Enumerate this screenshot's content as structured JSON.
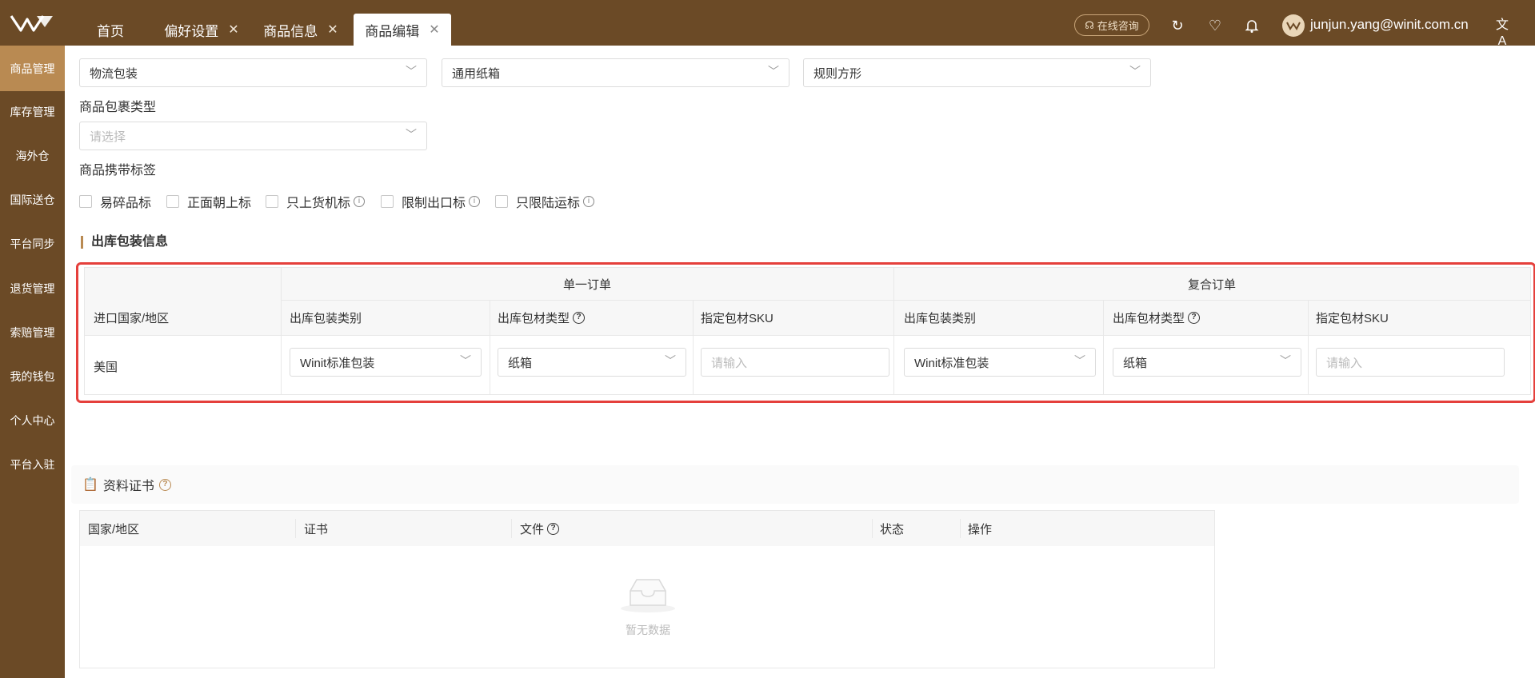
{
  "tabs": [
    {
      "label": "首页",
      "closable": false,
      "active": false
    },
    {
      "label": "偏好设置",
      "closable": true,
      "active": false
    },
    {
      "label": "商品信息",
      "closable": true,
      "active": false
    },
    {
      "label": "商品编辑",
      "closable": true,
      "active": true
    }
  ],
  "header": {
    "consult_label": "在线咨询",
    "username": "junjun.yang@winit.com.cn",
    "icons": [
      "refresh-icon",
      "shield-heart-icon",
      "bell-icon",
      "translate-icon"
    ]
  },
  "sidebar": {
    "items": [
      {
        "label": "商品管理",
        "active": true
      },
      {
        "label": "库存管理",
        "active": false
      },
      {
        "label": "海外仓",
        "active": false
      },
      {
        "label": "国际送仓",
        "active": false
      },
      {
        "label": "平台同步",
        "active": false
      },
      {
        "label": "退货管理",
        "active": false
      },
      {
        "label": "索赔管理",
        "active": false
      },
      {
        "label": "我的钱包",
        "active": false
      },
      {
        "label": "个人中心",
        "active": false
      },
      {
        "label": "平台入驻",
        "active": false
      }
    ]
  },
  "form": {
    "top_selects": [
      "物流包装",
      "通用纸箱",
      "规则方形"
    ],
    "package_type_label": "商品包裹类型",
    "package_type_placeholder": "请选择",
    "tags_label": "商品携带标签",
    "tags": [
      {
        "label": "易碎品标",
        "info": false
      },
      {
        "label": "正面朝上标",
        "info": false
      },
      {
        "label": "只上货机标",
        "info": true
      },
      {
        "label": "限制出口标",
        "info": true
      },
      {
        "label": "只限陆运标",
        "info": true
      }
    ]
  },
  "outbound": {
    "title": "出库包装信息",
    "group_single": "单一订单",
    "group_combined": "复合订单",
    "col_country": "进口国家/地区",
    "col_pack_category": "出库包装类别",
    "col_material_type": "出库包材类型",
    "col_sku": "指定包材SKU",
    "row": {
      "country": "美国",
      "single_category": "Winit标准包装",
      "single_material": "纸箱",
      "single_sku_placeholder": "请输入",
      "combined_category": "Winit标准包装",
      "combined_material": "纸箱",
      "combined_sku_placeholder": "请输入"
    }
  },
  "certificates": {
    "title": "资料证书",
    "columns": [
      "国家/地区",
      "证书",
      "文件",
      "状态",
      "操作"
    ],
    "empty_text": "暂无数据"
  },
  "colors": {
    "brand": "#6b4a26",
    "sidebar_active": "#b98a52",
    "highlight_border": "#e5403c"
  }
}
